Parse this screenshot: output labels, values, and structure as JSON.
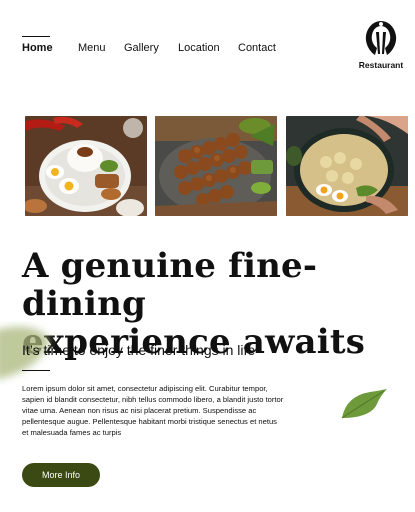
{
  "nav": {
    "items": [
      {
        "label": "Home",
        "active": true
      },
      {
        "label": "Menu",
        "active": false
      },
      {
        "label": "Gallery",
        "active": false
      },
      {
        "label": "Location",
        "active": false
      },
      {
        "label": "Contact",
        "active": false
      }
    ]
  },
  "brand": {
    "name": "Restaurant",
    "icon": "restaurant-logo-icon"
  },
  "gallery": {
    "images": [
      {
        "name": "rice-dish-photo"
      },
      {
        "name": "satay-skewers-photo"
      },
      {
        "name": "noodle-bowl-photo"
      }
    ]
  },
  "hero": {
    "title_line1": "A genuine fine-dining",
    "title_line2": "experience awaits",
    "subtitle": "It’s time to enjoy the finer things in life",
    "body": "Lorem ipsum dolor sit amet, consectetur adipiscing elit. Curabitur tempor, sapien id blandit consectetur, nibh tellus commodo libero, a blandit justo tortor vitae urna. Aenean non risus ac nisi placerat pretium. Suspendisse ac pellentesque augue. Pellentesque habitant morbi tristique senectus et netus et malesuada fames ac turpis",
    "button_label": "More Info"
  },
  "colors": {
    "accent": "#3a4a12",
    "leaf": "#6f9a3c"
  }
}
